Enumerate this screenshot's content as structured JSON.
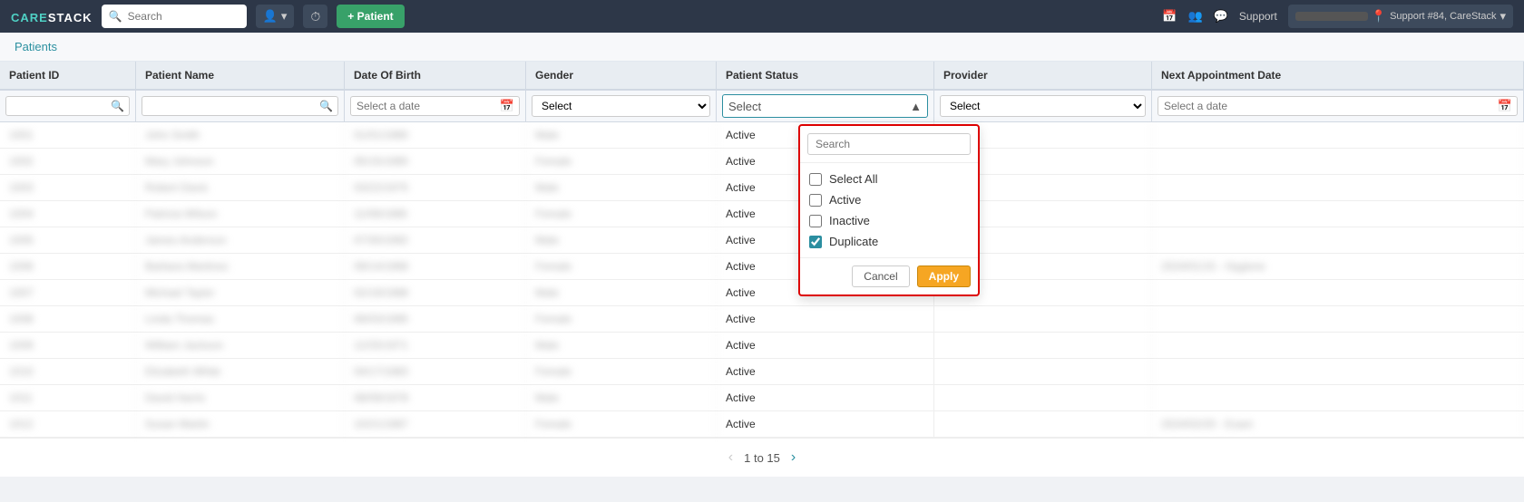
{
  "nav": {
    "logo_care": "CARE",
    "logo_stack": "STACK",
    "search_placeholder": "Search",
    "add_patient_label": "+ Patient",
    "support_label": "Support",
    "support_ticket": "Support #84, CareStack"
  },
  "breadcrumb": {
    "label": "Patients"
  },
  "table": {
    "columns": [
      "Patient ID",
      "Patient Name",
      "Date Of Birth",
      "Gender",
      "Patient Status",
      "Provider",
      "Next Appointment Date"
    ],
    "filters": {
      "patient_id_placeholder": "",
      "patient_name_placeholder": "",
      "date_of_birth_placeholder": "Select a date",
      "gender_placeholder": "Select",
      "patient_status_placeholder": "Select",
      "provider_placeholder": "Select",
      "next_appt_placeholder": "Select a date"
    },
    "rows": [
      {
        "id": "",
        "name": "",
        "dob": "",
        "gender": "",
        "status": "Active",
        "provider": "",
        "next_appt": ""
      },
      {
        "id": "",
        "name": "",
        "dob": "",
        "gender": "",
        "status": "Active",
        "provider": "",
        "next_appt": ""
      },
      {
        "id": "",
        "name": "",
        "dob": "",
        "gender": "",
        "status": "Active",
        "provider": "",
        "next_appt": ""
      },
      {
        "id": "",
        "name": "",
        "dob": "",
        "gender": "",
        "status": "Active",
        "provider": "",
        "next_appt": ""
      },
      {
        "id": "",
        "name": "",
        "dob": "",
        "gender": "",
        "status": "Active",
        "provider": "",
        "next_appt": ""
      },
      {
        "id": "",
        "name": "",
        "dob": "",
        "gender": "",
        "status": "Active",
        "provider": "",
        "next_appt": ""
      },
      {
        "id": "",
        "name": "",
        "dob": "",
        "gender": "",
        "status": "Active",
        "provider": "",
        "next_appt": ""
      },
      {
        "id": "",
        "name": "",
        "dob": "",
        "gender": "",
        "status": "Active",
        "provider": "",
        "next_appt": ""
      },
      {
        "id": "",
        "name": "",
        "dob": "",
        "gender": "",
        "status": "Active",
        "provider": "",
        "next_appt": ""
      },
      {
        "id": "",
        "name": "",
        "dob": "",
        "gender": "",
        "status": "Active",
        "provider": "",
        "next_appt": ""
      },
      {
        "id": "",
        "name": "",
        "dob": "",
        "gender": "",
        "status": "Active",
        "provider": "",
        "next_appt": ""
      },
      {
        "id": "",
        "name": "",
        "dob": "",
        "gender": "",
        "status": "Active",
        "provider": "",
        "next_appt": ""
      }
    ]
  },
  "dropdown": {
    "search_placeholder": "Search",
    "select_all_label": "Select All",
    "options": [
      {
        "label": "Active",
        "checked": false
      },
      {
        "label": "Inactive",
        "checked": false
      },
      {
        "label": "Duplicate",
        "checked": true
      }
    ],
    "cancel_label": "Cancel",
    "apply_label": "Apply"
  },
  "pagination": {
    "text": "1 to 15"
  }
}
